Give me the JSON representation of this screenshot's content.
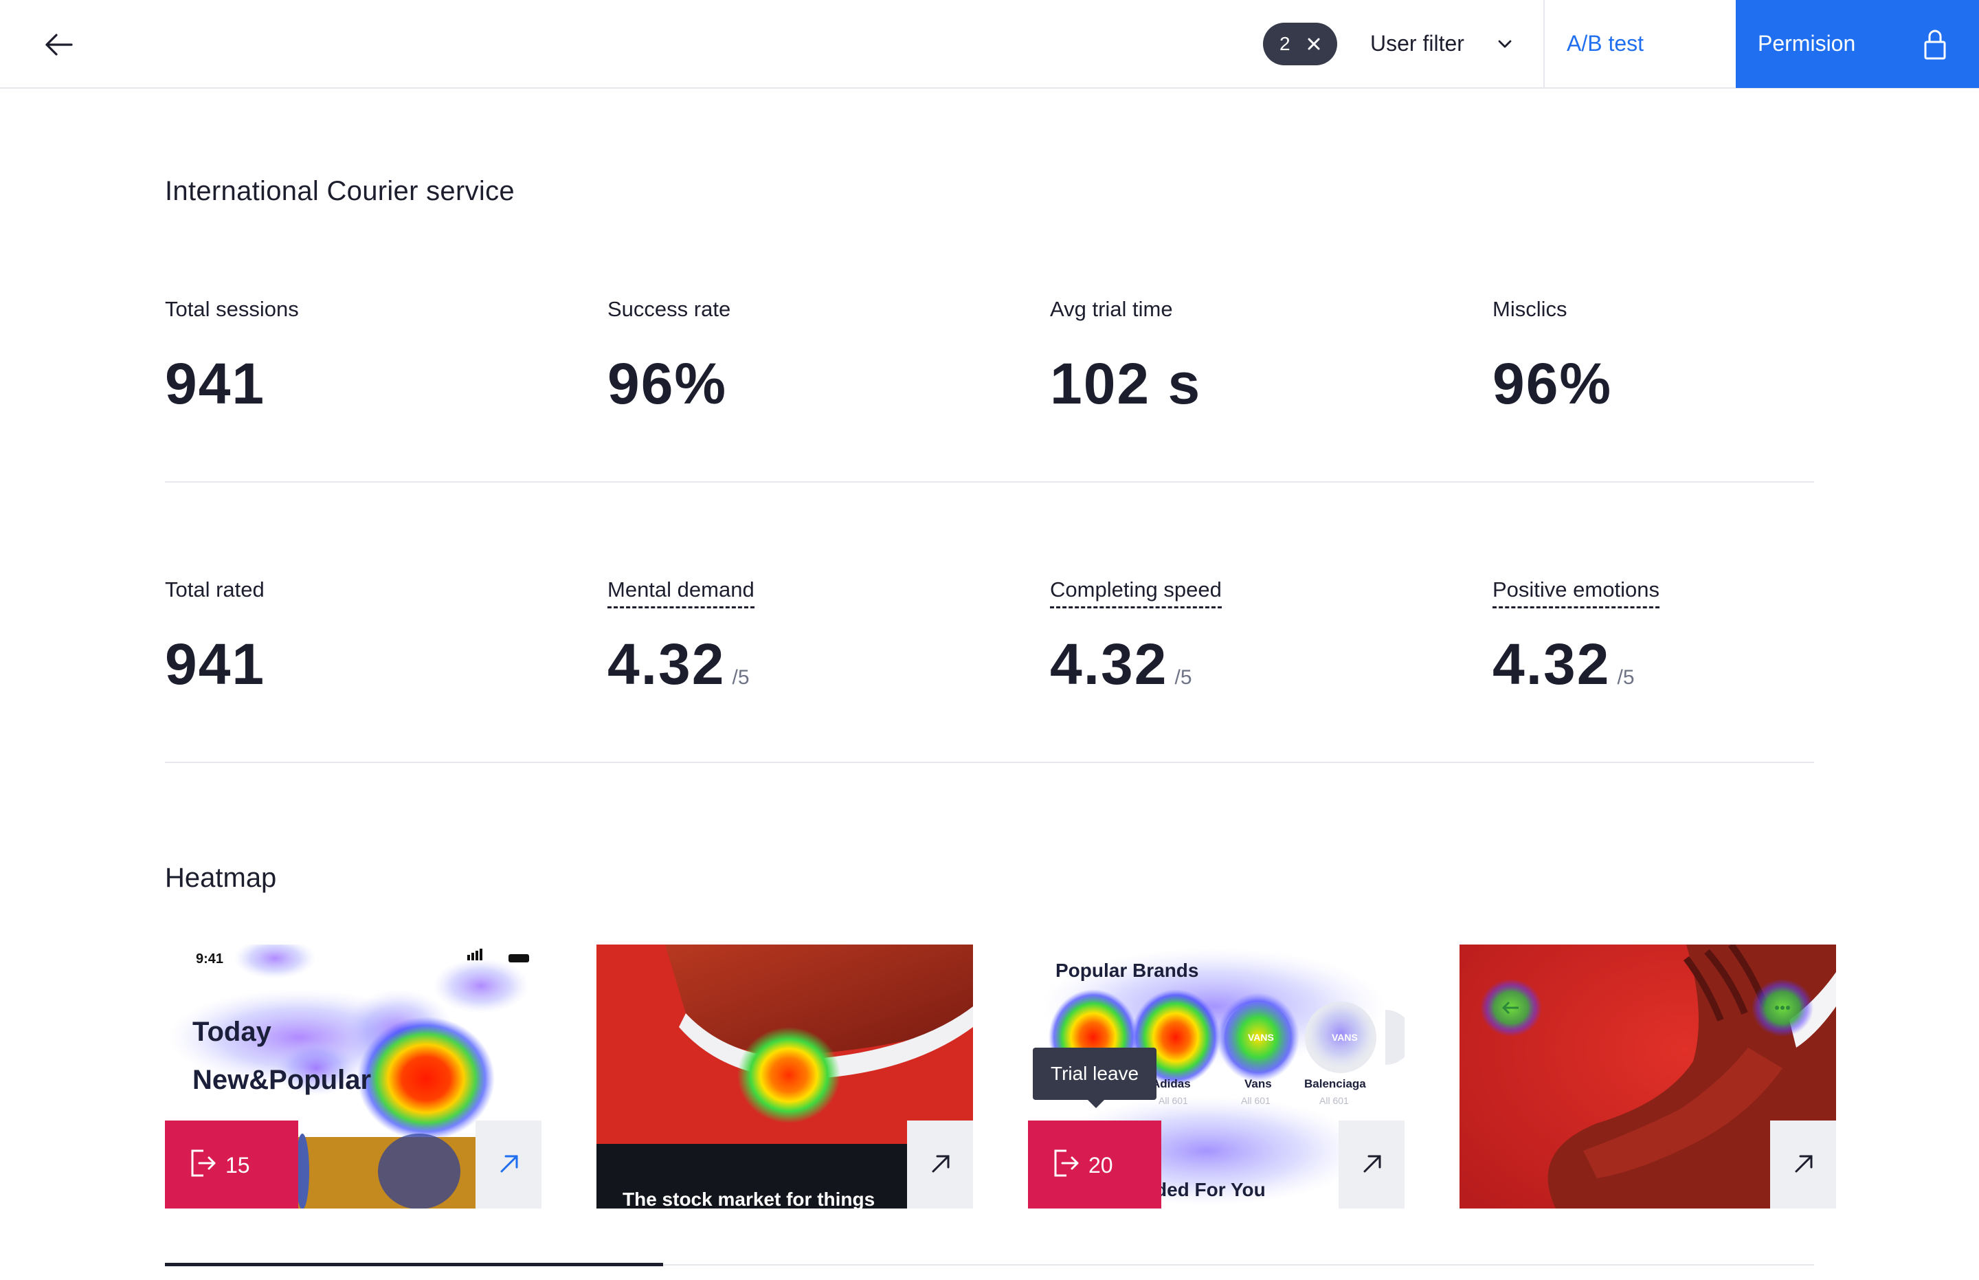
{
  "topbar": {
    "filter_count": "2",
    "user_filter_label": "User filter",
    "ab_test_label": "A/B test",
    "permission_label": "Permision"
  },
  "page": {
    "title": "International Courier service"
  },
  "stats_row1": [
    {
      "label": "Total sessions",
      "value": "941"
    },
    {
      "label": "Success rate",
      "value": "96%"
    },
    {
      "label": "Avg trial time",
      "value": "102 s"
    },
    {
      "label": "Misclics",
      "value": "96%"
    }
  ],
  "stats_row2": [
    {
      "label": "Total rated",
      "value": "941",
      "suffix": ""
    },
    {
      "label": "Mental demand",
      "value": "4.32",
      "suffix": "/5"
    },
    {
      "label": "Completing speed",
      "value": "4.32",
      "suffix": "/5"
    },
    {
      "label": "Positive emotions",
      "value": "4.32",
      "suffix": "/5"
    }
  ],
  "heatmap": {
    "title": "Heatmap",
    "cards": [
      {
        "time": "9:41",
        "line1": "Today",
        "line2": "New&Popular",
        "leave_count": "15"
      },
      {
        "caption": "The stock market for things"
      },
      {
        "heading": "Popular Brands",
        "brands": [
          "Adidas",
          "Vans",
          "Balenciaga"
        ],
        "sub": "All 601",
        "logo_text": "VANS",
        "bottom_text": "ded For You",
        "leave_count": "20"
      },
      {}
    ],
    "tooltip": "Trial leave",
    "progress": 0.302
  },
  "colors": {
    "accent": "#1f6ff0",
    "leave": "#d81b50",
    "dark": "#1c1e2e"
  }
}
